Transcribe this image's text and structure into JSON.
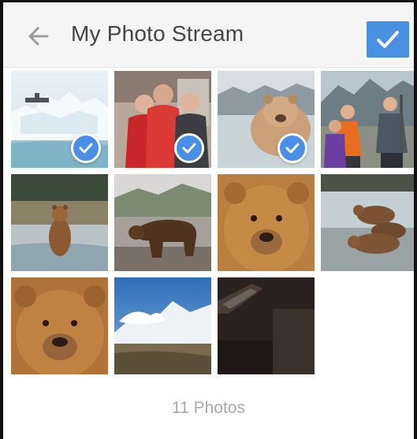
{
  "header": {
    "title": "My Photo Stream",
    "back_icon": "arrow-left-icon",
    "done_icon": "checkmark-icon"
  },
  "colors": {
    "accent": "#4a90e2",
    "title_text": "#454545",
    "footer_text": "#a8a8a8",
    "header_bg": "#f5f5f5"
  },
  "photos": [
    {
      "subject": "iceberg",
      "selected": true
    },
    {
      "subject": "two-people",
      "selected": true
    },
    {
      "subject": "bear-water",
      "selected": true
    },
    {
      "subject": "hikers",
      "selected": false
    },
    {
      "subject": "bear-standing",
      "selected": false
    },
    {
      "subject": "bear-walking",
      "selected": false
    },
    {
      "subject": "bear-face",
      "selected": false
    },
    {
      "subject": "bears-resting",
      "selected": false
    },
    {
      "subject": "bear-face",
      "selected": false
    },
    {
      "subject": "mountain",
      "selected": false
    },
    {
      "subject": "dark-object",
      "selected": false
    }
  ],
  "footer": {
    "count_label": "11 Photos"
  }
}
